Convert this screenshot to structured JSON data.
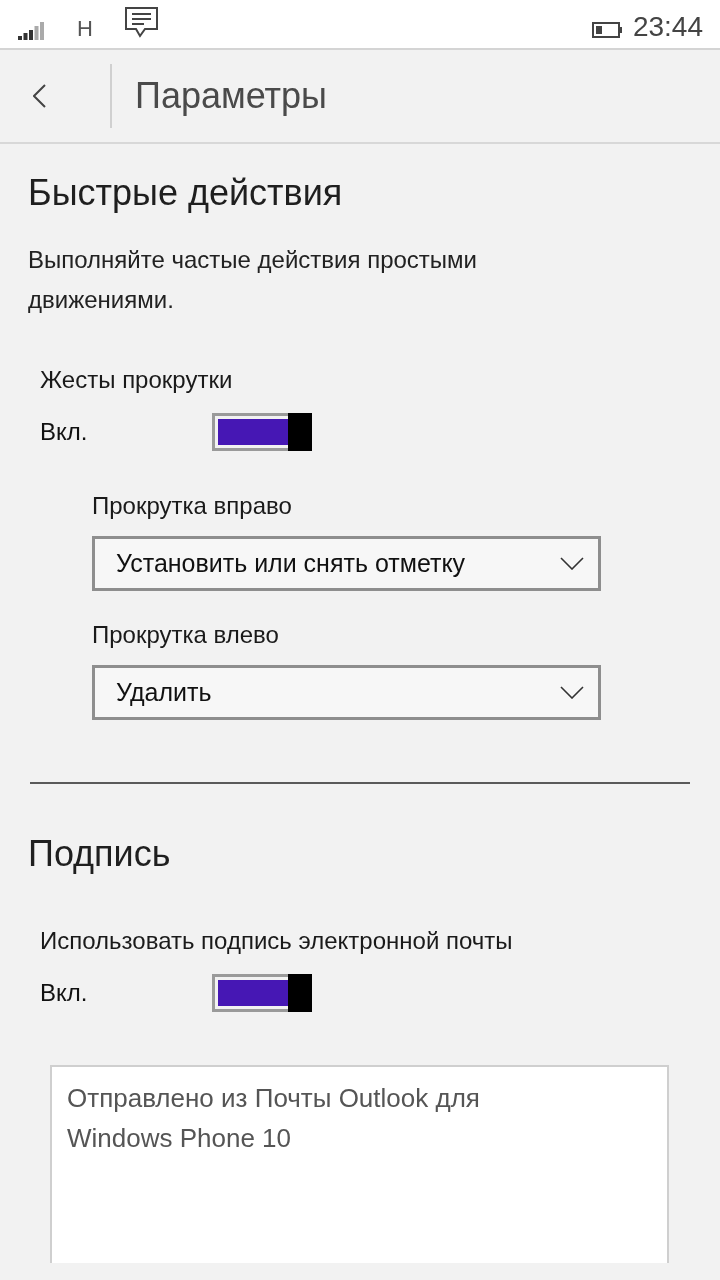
{
  "status_bar": {
    "network": "H",
    "time": "23:44"
  },
  "header": {
    "title": "Параметры"
  },
  "sections": [
    {
      "title": "Быстрые действия",
      "description": "Выполняйте частые действия простыми движениями.",
      "items": [
        {
          "kind": "toggle",
          "label": "Жесты прокрутки",
          "state_label": "Вкл.",
          "on": true,
          "children": [
            {
              "kind": "dropdown",
              "label": "Прокрутка вправо",
              "value": "Установить или снять отметку"
            },
            {
              "kind": "dropdown",
              "label": "Прокрутка влево",
              "value": "Удалить"
            }
          ]
        }
      ]
    },
    {
      "title": "Подпись",
      "items": [
        {
          "kind": "toggle",
          "label": "Использовать подпись электронной почты",
          "state_label": "Вкл.",
          "on": true
        },
        {
          "kind": "textarea",
          "value": "Отправлено из Почты Outlook для Windows Phone 10"
        }
      ]
    }
  ]
}
